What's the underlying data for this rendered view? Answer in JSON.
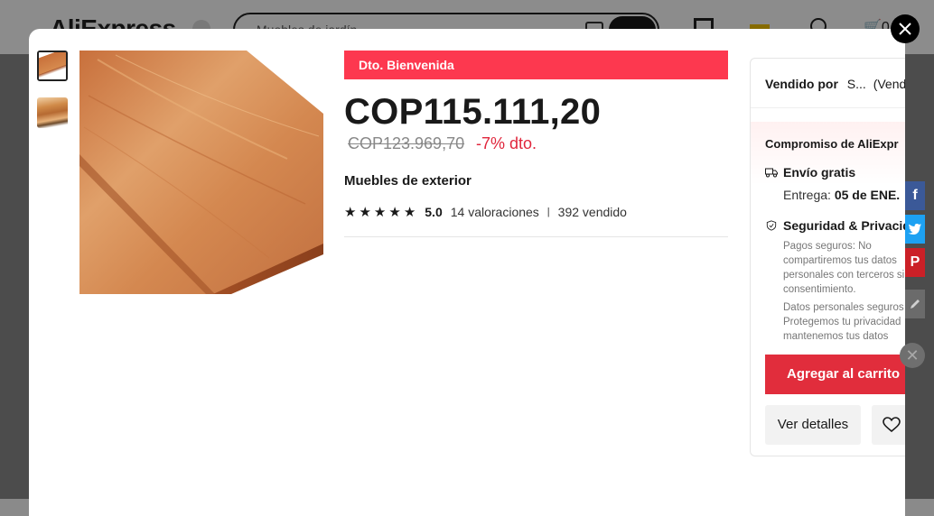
{
  "background": {
    "logo": "AliExpress",
    "search_placeholder": "Muebles de jardín",
    "cart_count": "0"
  },
  "modal": {
    "promo_badge": "Dto. Bienvenida",
    "price": "COP115.111,20",
    "original_price": "COP123.969,70",
    "discount": "-7% dto.",
    "title": "Muebles de exterior",
    "rating": "5.0",
    "reviews": "14 valoraciones",
    "separator": "|",
    "sold": "392 vendido",
    "star_count": 5,
    "thumbnails": [
      "wood-plank-thumbnail",
      "wood-stack-thumbnail"
    ]
  },
  "side": {
    "sold_by_label": "Vendido por",
    "seller_name": "S...",
    "seller_extra": "(Vende",
    "commitment_title": "Compromiso de AliExpr",
    "shipping_title": "Envío gratis",
    "delivery_label": "Entrega:",
    "delivery_date": "05 de ENE.",
    "security_title": "Seguridad & Privacid",
    "security_text_1": "Pagos seguros: No compartiremos tus datos personales con terceros si tu consentimiento.",
    "security_text_2": "Datos personales seguros Protegemos tu privacidad mantenemos tus datos",
    "add_to_cart": "Agregar al carrito",
    "view_details": "Ver detalles"
  },
  "colors": {
    "promo": "#fd384f",
    "discount": "#e0263c",
    "add_to_cart": "#e12d3c",
    "facebook": "#3b5998",
    "twitter": "#1da1f2",
    "pinterest": "#cb2027"
  },
  "social": {
    "facebook": "f",
    "pinterest": "P"
  }
}
